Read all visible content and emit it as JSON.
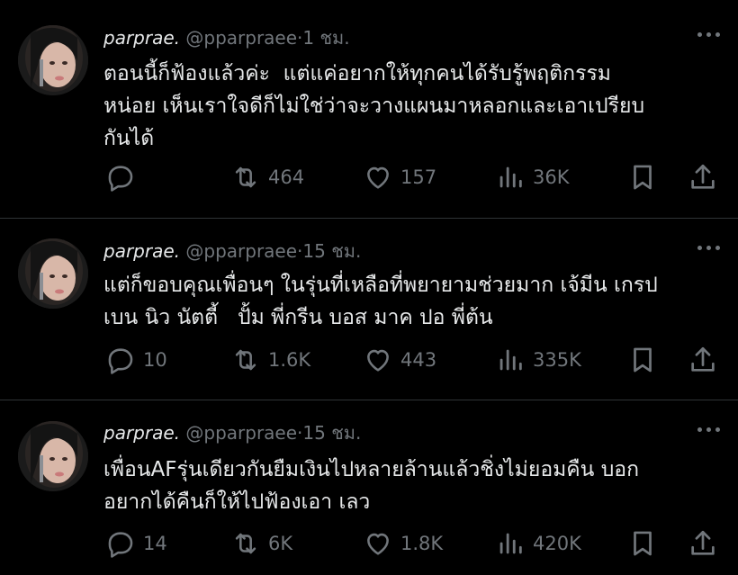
{
  "tweets": [
    {
      "name": "parprae.",
      "handle": "@pparpraee",
      "dot": "·",
      "time": "1 ชม.",
      "text": "ตอนนี้ก็ฟ้องแล้วค่ะ  แต่แค่อยากให้ทุกคนได้รับรู้พฤติกรรม\nหน่อย เห็นเราใจดีก็ไม่ใช่ว่าจะวางแผนมาหลอกและเอาเปรียบ\nกันได้",
      "replies": "",
      "reposts": "464",
      "likes": "157",
      "views": "36K"
    },
    {
      "name": "parprae.",
      "handle": "@pparpraee",
      "dot": "·",
      "time": "15 ชม.",
      "text": "แต่ก็ขอบคุณเพื่อนๆ ในรุ่นที่เหลือที่พยายามช่วยมาก เจ้มีน เกรป\nเบน นิว นัตตี้   ปั้ม พี่กรีน บอส มาค ปอ พี่ต้น",
      "replies": "10",
      "reposts": "1.6K",
      "likes": "443",
      "views": "335K"
    },
    {
      "name": "parprae.",
      "handle": "@pparpraee",
      "dot": "·",
      "time": "15 ชม.",
      "text": "เพื่อนAFรุ่นเดียวกันยืมเงินไปหลายล้านแล้วชิ่งไม่ยอมคืน บอก\nอยากได้คืนก็ให้ไปฟ้องเอา เลว",
      "replies": "14",
      "reposts": "6K",
      "likes": "1.8K",
      "views": "420K"
    }
  ],
  "icons": {
    "reply": "speech-bubble-icon",
    "repost": "repost-arrows-icon",
    "like": "heart-icon",
    "views": "bar-chart-icon",
    "bookmark": "bookmark-icon",
    "share": "share-upload-icon",
    "more": "more-dots-icon"
  },
  "colors": {
    "background": "#000000",
    "text": "#e7e9ea",
    "secondary": "#71767b",
    "divider": "#2f3336"
  }
}
